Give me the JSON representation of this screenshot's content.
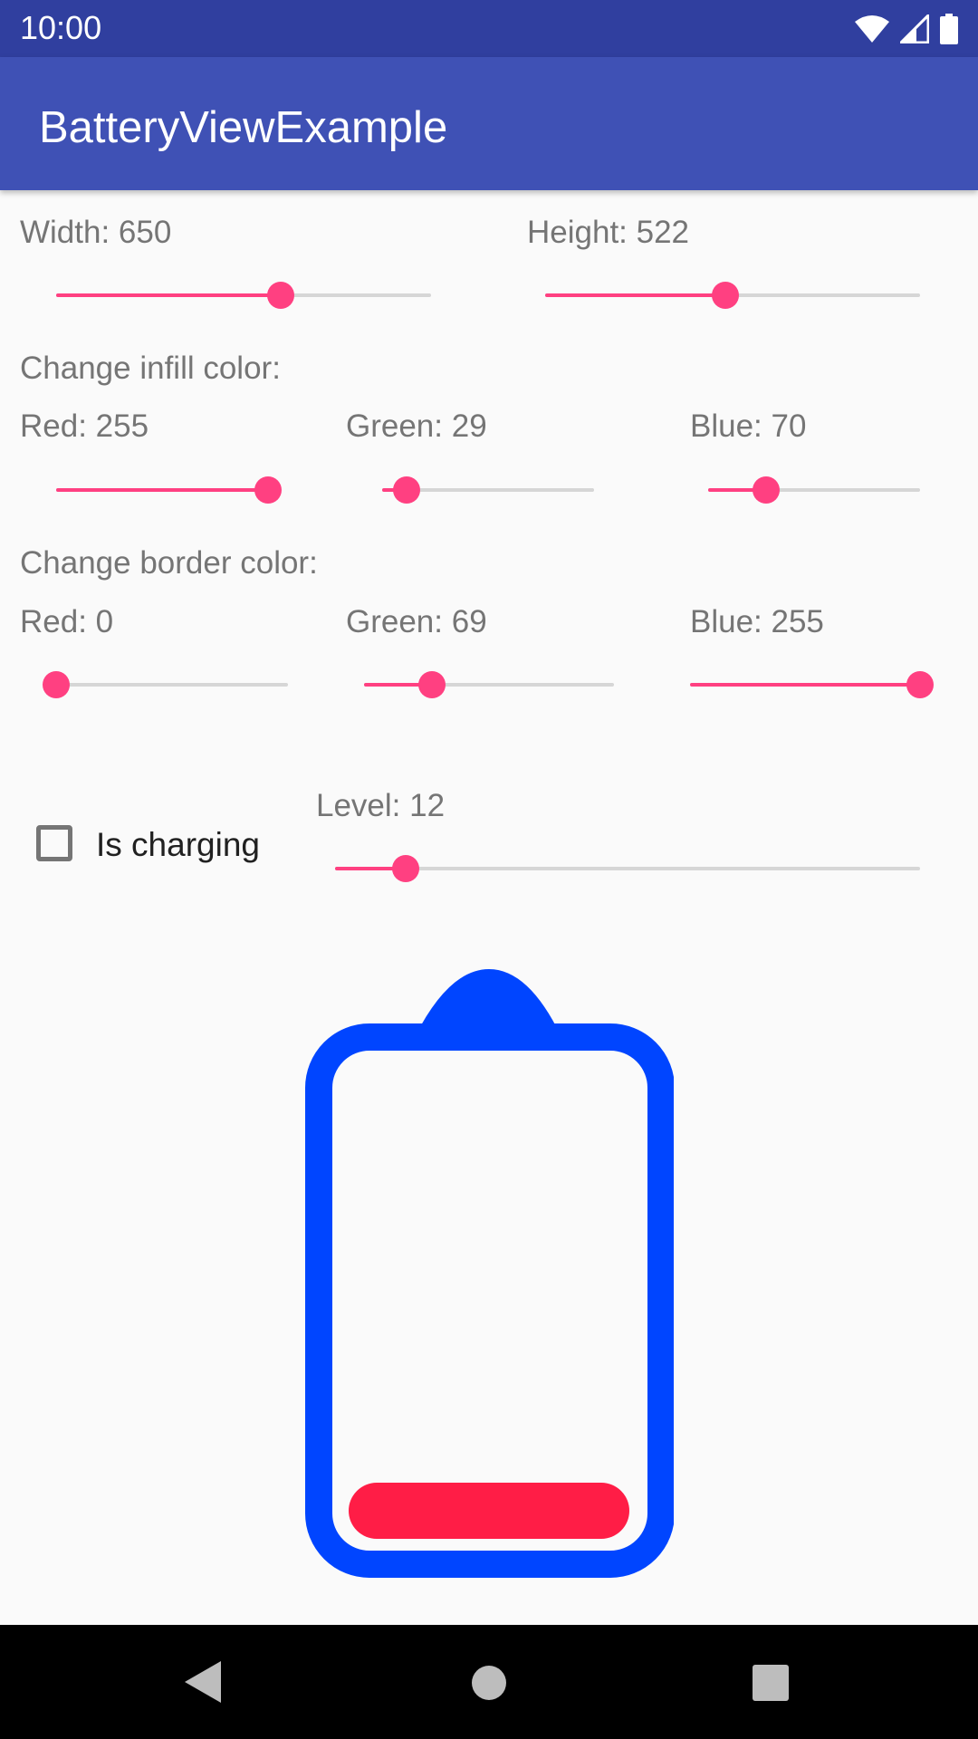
{
  "status_bar": {
    "time": "10:00"
  },
  "app_bar": {
    "title": "BatteryViewExample"
  },
  "size": {
    "width_label": "Width: 650",
    "width_fraction": 0.6,
    "height_label": "Height: 522",
    "height_fraction": 0.48
  },
  "infill": {
    "heading": "Change infill color:",
    "red_label": "Red: 255",
    "red_value": 255,
    "green_label": "Green: 29",
    "green_value": 29,
    "blue_label": "Blue: 70",
    "blue_value": 70
  },
  "border": {
    "heading": "Change border color:",
    "red_label": "Red: 0",
    "red_value": 0,
    "green_label": "Green: 69",
    "green_value": 69,
    "blue_label": "Blue: 255",
    "blue_value": 255
  },
  "charging": {
    "label": "Is charging",
    "checked": false
  },
  "level": {
    "label": "Level: 12",
    "value": 12
  },
  "colors": {
    "accent": "#FF4081",
    "primary": "#3F51B5",
    "primary_dark": "#303F9F",
    "battery_border": "#0045FF",
    "battery_infill": "#FF1D46"
  },
  "icons": {
    "status": [
      "wifi-icon",
      "signal-icon",
      "battery-icon"
    ],
    "nav": [
      "back-icon",
      "home-icon",
      "recents-icon"
    ]
  }
}
